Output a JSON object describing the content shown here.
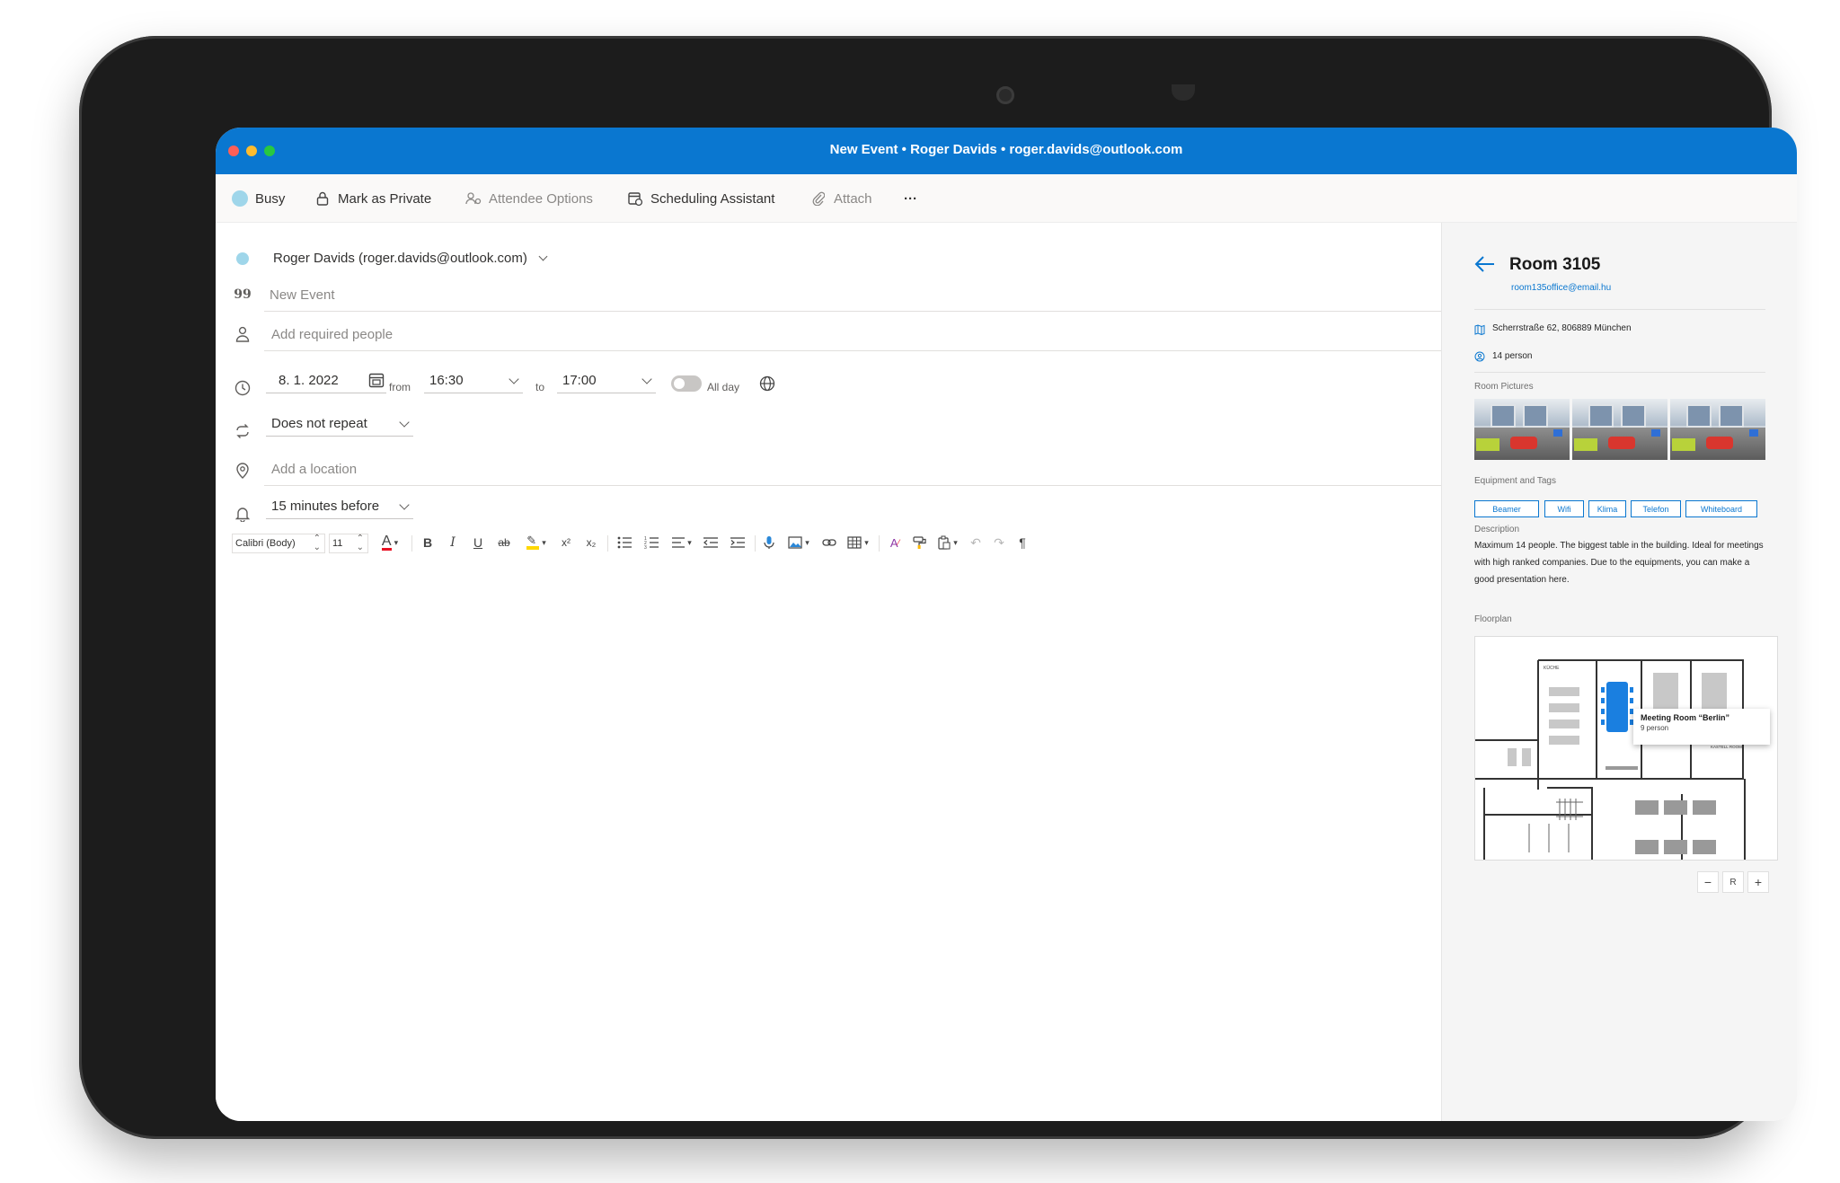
{
  "window": {
    "title": "New Event • Roger Davids • roger.davids@outlook.com"
  },
  "commandbar": {
    "busy": "Busy",
    "mark_private": "Mark as Private",
    "attendee_options": "Attendee Options",
    "scheduling_assistant": "Scheduling Assistant",
    "attach": "Attach",
    "more": "···"
  },
  "form": {
    "organizer": "Roger Davids (roger.davids@outlook.com)",
    "title_placeholder": "New Event",
    "people_placeholder": "Add required people",
    "date": "8.  1. 2022",
    "from_label": "from",
    "start_time": "16:30",
    "to_label": "to",
    "end_time": "17:00",
    "all_day": "All day",
    "repeat": "Does not repeat",
    "location_placeholder": "Add a location",
    "reminder": "15 minutes before"
  },
  "toolbar": {
    "font": "Calibri (Body)",
    "size": "11",
    "bold": "B",
    "italic": "I",
    "underline": "U",
    "strike": "ab",
    "paragraph": "¶"
  },
  "room": {
    "title": "Room 3105",
    "email": "room135office@email.hu",
    "address": "Scherrstraße 62, 806889 München",
    "capacity": "14 person",
    "pictures_label": "Room Pictures",
    "equipment_label": "Equipment and Tags",
    "tags": [
      "Beamer",
      "Wifi",
      "Klima",
      "Telefon",
      "Whiteboard"
    ],
    "description_label": "Description",
    "description": "Maximum 14 people. The biggest table in the building. Ideal for meetings with high ranked companies. Due to the equipments, you can make a good presentation here.",
    "floorplan_label": "Floorplan",
    "tooltip_title": "Meeting Room “Berlin”",
    "tooltip_sub": "9 person",
    "floor_labels": [
      "KÜCHE",
      "KASTELL ROOM"
    ],
    "zoom_out": "−",
    "zoom_reset": "R",
    "zoom_in": "+"
  },
  "colors": {
    "accent": "#0a77d0",
    "busy": "#9fd6ea",
    "font_color": "#e81123",
    "highlight": "#ffd800"
  }
}
